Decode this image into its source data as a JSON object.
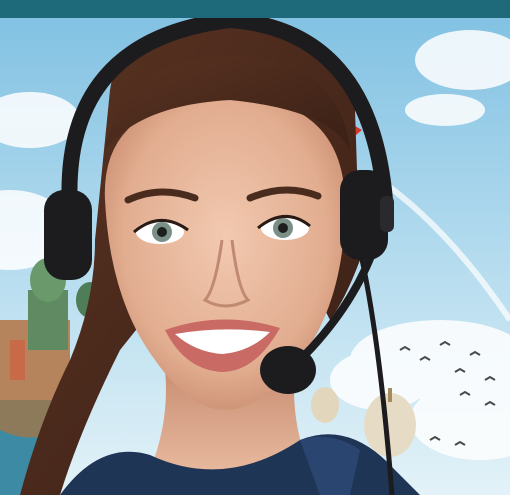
{
  "image": {
    "subject": "smiling-call-center-agent-with-headset",
    "background": "sky-with-clouds-and-cathedral-domes",
    "colors": {
      "top_bar": "#1e6a7a",
      "sky_top": "#8ec9e6",
      "sky_bottom": "#d8eef6",
      "skin": "#e8b79c",
      "hair": "#4a2a1c",
      "headset": "#1c1c1e",
      "jacket": "#1f3556",
      "lips": "#c96a64"
    }
  }
}
